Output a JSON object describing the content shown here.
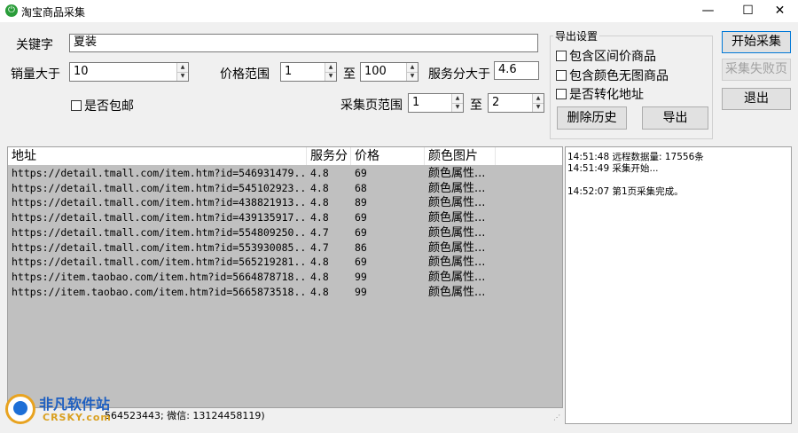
{
  "window": {
    "title": "淘宝商品采集",
    "minimize": "—",
    "maximize": "☐",
    "close": "✕"
  },
  "form": {
    "keyword_label": "关键字",
    "keyword_value": "夏装",
    "sales_label": "销量大于",
    "sales_value": "10",
    "price_label": "价格范围",
    "price_min": "1",
    "to_label": "至",
    "price_max": "100",
    "service_label": "服务分大于",
    "service_value": "4.6",
    "free_shipping_label": "是否包邮",
    "pages_label": "采集页范围",
    "page_min": "1",
    "page_to_label": "至",
    "page_max": "2"
  },
  "export_group": {
    "title": "导出设置",
    "options": [
      "包含区间价商品",
      "包含颜色无图商品",
      "是否转化地址"
    ],
    "delete_history": "删除历史",
    "export": "导出"
  },
  "actions": {
    "start": "开始采集",
    "retry_failed": "采集失败页",
    "exit": "退出"
  },
  "table": {
    "columns": [
      "地址",
      "服务分",
      "价格",
      "颜色图片"
    ],
    "rows": [
      [
        "https://detail.tmall.com/item.htm?id=546931479...",
        "4.8",
        "69",
        "颜色属性..."
      ],
      [
        "https://detail.tmall.com/item.htm?id=545102923...",
        "4.8",
        "68",
        "颜色属性..."
      ],
      [
        "https://detail.tmall.com/item.htm?id=438821913...",
        "4.8",
        "89",
        "颜色属性..."
      ],
      [
        "https://detail.tmall.com/item.htm?id=439135917...",
        "4.8",
        "69",
        "颜色属性..."
      ],
      [
        "https://detail.tmall.com/item.htm?id=554809250...",
        "4.7",
        "69",
        "颜色属性..."
      ],
      [
        "https://detail.tmall.com/item.htm?id=553930085...",
        "4.7",
        "86",
        "颜色属性..."
      ],
      [
        "https://detail.tmall.com/item.htm?id=565219281...",
        "4.8",
        "69",
        "颜色属性..."
      ],
      [
        "https://item.taobao.com/item.htm?id=5664878718...",
        "4.8",
        "99",
        "颜色属性..."
      ],
      [
        "https://item.taobao.com/item.htm?id=5665873518...",
        "4.8",
        "99",
        "颜色属性..."
      ]
    ]
  },
  "log": [
    "14:51:48 远程数据量: 17556条",
    "14:51:49  采集开始...",
    "",
    "14:52:07  第1页采集完成。"
  ],
  "status": {
    "text": "564523443; 微信: 13124458119)"
  },
  "watermark": {
    "title": "非凡软件站",
    "subtitle": "CRSKY.com"
  }
}
